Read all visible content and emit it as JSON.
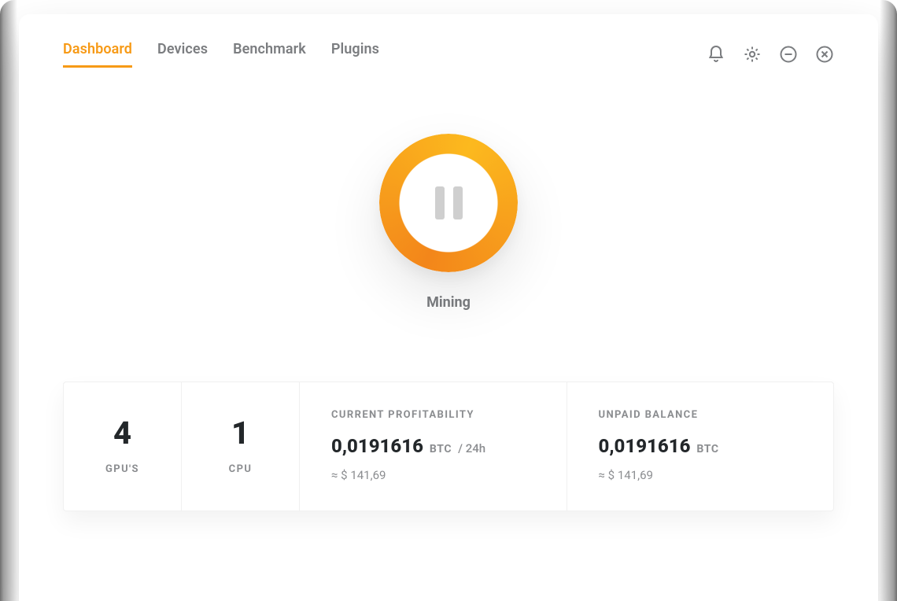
{
  "nav": {
    "tabs": [
      {
        "label": "Dashboard",
        "active": true
      },
      {
        "label": "Devices",
        "active": false
      },
      {
        "label": "Benchmark",
        "active": false
      },
      {
        "label": "Plugins",
        "active": false
      }
    ]
  },
  "mining": {
    "status_label": "Mining"
  },
  "stats": {
    "gpu": {
      "count": "4",
      "label": "GPU'S"
    },
    "cpu": {
      "count": "1",
      "label": "CPU"
    },
    "profitability": {
      "title": "CURRENT PROFITABILITY",
      "value": "0,0191616",
      "unit": "BTC",
      "per": "/ 24h",
      "approx": "≈ $ 141,69"
    },
    "balance": {
      "title": "UNPAID BALANCE",
      "value": "0,0191616",
      "unit": "BTC",
      "approx": "≈ $ 141,69"
    }
  },
  "colors": {
    "accent": "#f79a16"
  }
}
